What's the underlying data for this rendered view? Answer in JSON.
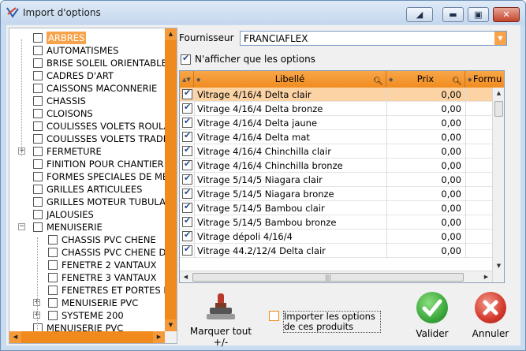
{
  "window": {
    "title": "Import d'options"
  },
  "tree": {
    "items": [
      {
        "label": "ARBRES",
        "level": 0,
        "selected": true,
        "expander": false
      },
      {
        "label": "AUTOMATISMES",
        "level": 0
      },
      {
        "label": "BRISE SOLEIL ORIENTABLE",
        "level": 0
      },
      {
        "label": "CADRES D'ART",
        "level": 0
      },
      {
        "label": "CAISSONS MACONNERIE",
        "level": 0
      },
      {
        "label": "CHASSIS",
        "level": 0
      },
      {
        "label": "CLOISONS",
        "level": 0
      },
      {
        "label": "COULISSES VOLETS ROULANTS",
        "level": 0
      },
      {
        "label": "COULISSES VOLETS TRADITIONNELS",
        "level": 0
      },
      {
        "label": "FERMETURE",
        "level": 0,
        "expander": "+"
      },
      {
        "label": "FINITION POUR CHANTIER",
        "level": 0
      },
      {
        "label": "FORMES SPECIALES DE MENUISERIE",
        "level": 0
      },
      {
        "label": "GRILLES ARTICULEES",
        "level": 0
      },
      {
        "label": "GRILLES MOTEUR TUBULAIRE",
        "level": 0
      },
      {
        "label": "JALOUSIES",
        "level": 0
      },
      {
        "label": "MENUISERIE",
        "level": 0,
        "expander": "−"
      },
      {
        "label": "CHASSIS PVC CHENE",
        "level": 1
      },
      {
        "label": "CHASSIS PVC CHENE DORE",
        "level": 1
      },
      {
        "label": "FENETRE 2 VANTAUX",
        "level": 1
      },
      {
        "label": "FENETRE 3 VANTAUX",
        "level": 1
      },
      {
        "label": "FENETRES ET PORTES FENETRES",
        "level": 1
      },
      {
        "label": "MENUISERIE PVC",
        "level": 1,
        "expander": "+"
      },
      {
        "label": "SYSTEME 200",
        "level": 1,
        "expander": "+"
      },
      {
        "label": "MENUISERIE PVC",
        "level": 0
      }
    ]
  },
  "fournisseur": {
    "label": "Fournisseur",
    "value": "FRANCIAFLEX"
  },
  "filter": {
    "label": "N'afficher que les options",
    "checked": true
  },
  "grid": {
    "columns": [
      "Libellé",
      "Prix",
      "Formu"
    ],
    "rows": [
      {
        "libelle": "Vitrage 4/16/4 Delta clair",
        "prix": "0,00",
        "checked": true,
        "selected": true
      },
      {
        "libelle": "Vitrage 4/16/4 Delta bronze",
        "prix": "0,00",
        "checked": true
      },
      {
        "libelle": "Vitrage 4/16/4 Delta jaune",
        "prix": "0,00",
        "checked": true
      },
      {
        "libelle": "Vitrage 4/16/4 Delta mat",
        "prix": "0,00",
        "checked": true
      },
      {
        "libelle": "Vitrage 4/16/4 Chinchilla clair",
        "prix": "0,00",
        "checked": true
      },
      {
        "libelle": "Vitrage 4/16/4 Chinchilla bronze",
        "prix": "0,00",
        "checked": true
      },
      {
        "libelle": "Vitrage 5/14/5 Niagara clair",
        "prix": "0,00",
        "checked": true
      },
      {
        "libelle": "Vitrage 5/14/5 Niagara bronze",
        "prix": "0,00",
        "checked": true
      },
      {
        "libelle": "Vitrage 5/14/5 Bambou clair",
        "prix": "0,00",
        "checked": true
      },
      {
        "libelle": "Vitrage 5/14/5 Bambou bronze",
        "prix": "0,00",
        "checked": true
      },
      {
        "libelle": "Vitrage dépoli 4/16/4",
        "prix": "0,00",
        "checked": true
      },
      {
        "libelle": "Vitrage 44.2/12/4 Delta clair",
        "prix": "0,00",
        "checked": true
      }
    ]
  },
  "actions": {
    "marquer": "Marquer tout +/-",
    "importer_line1": "Importer les options",
    "importer_line2": "de ces produits",
    "importer_checked": false,
    "valider": "Valider",
    "annuler": "Annuler"
  },
  "colors": {
    "accent": "#f18c1f",
    "selection": "#fbd3a5",
    "valider": "#3da83d",
    "annuler": "#d33a2c"
  }
}
